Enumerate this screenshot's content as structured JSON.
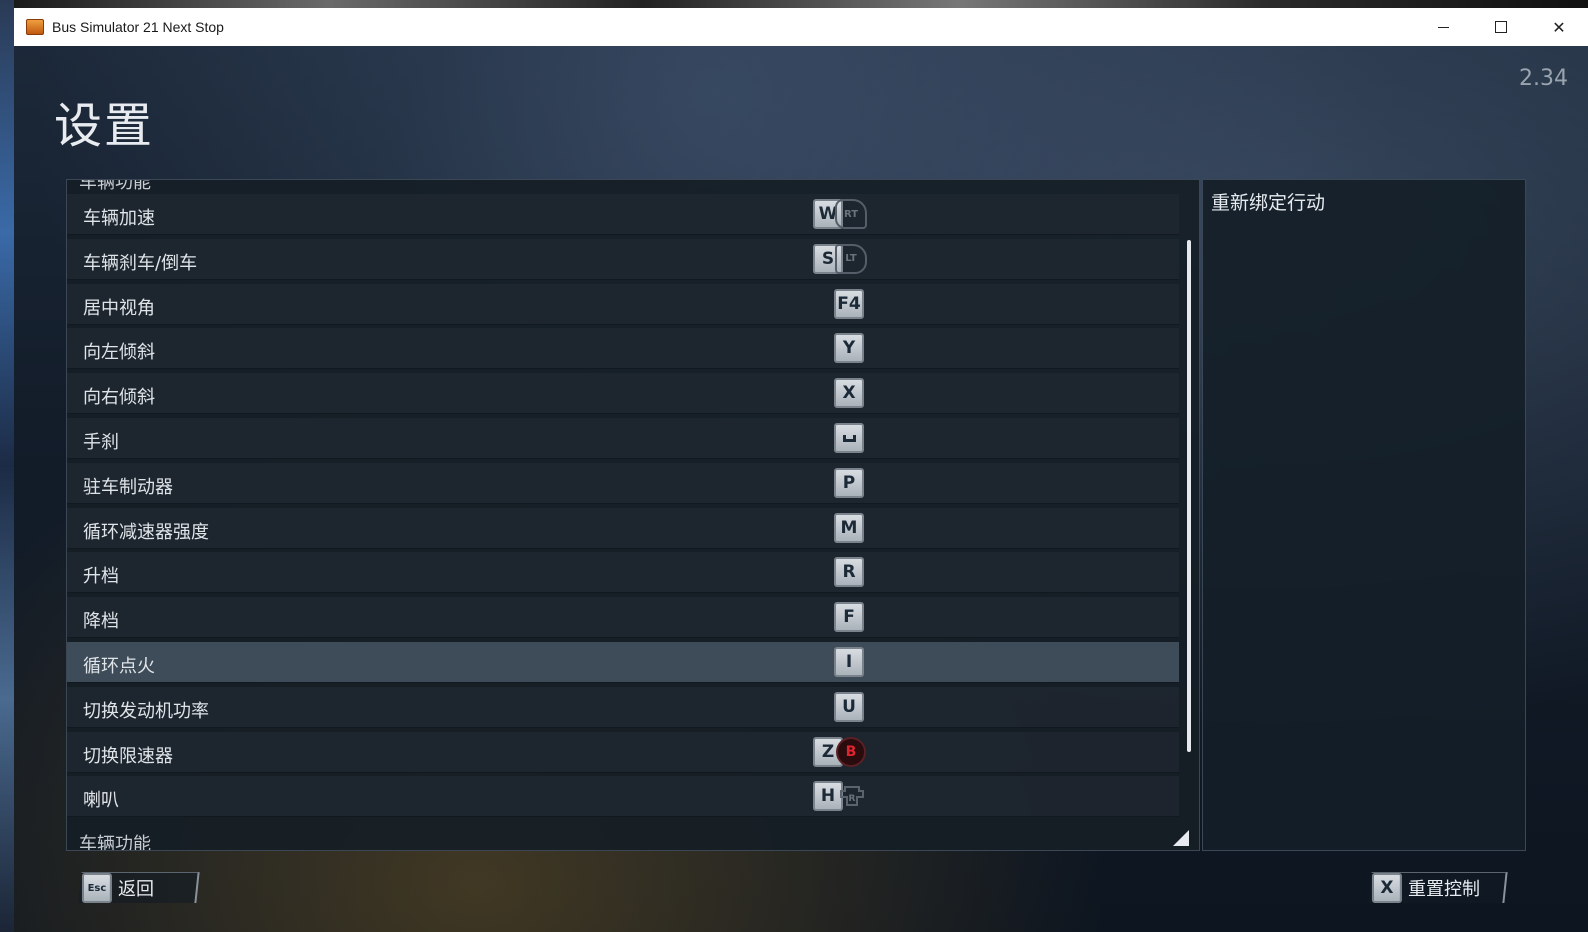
{
  "window": {
    "title": "Bus Simulator 21 Next Stop",
    "minimize_glyph": "minimize",
    "maximize_glyph": "maximize",
    "close_glyph": "✕"
  },
  "page": {
    "title": "设置",
    "version": "2.34"
  },
  "bindings": {
    "section_header_cut": "车辆功能",
    "rows": [
      {
        "label": "车辆加速",
        "key": "W",
        "pad": "RT",
        "pad_type": "trigger-rt"
      },
      {
        "label": "车辆刹车/倒车",
        "key": "S",
        "pad": "LT",
        "pad_type": "trigger-lt"
      },
      {
        "label": "居中视角",
        "key": "F4",
        "pad": "",
        "pad_type": ""
      },
      {
        "label": "向左倾斜",
        "key": "Y",
        "pad": "",
        "pad_type": ""
      },
      {
        "label": "向右倾斜",
        "key": "X",
        "pad": "",
        "pad_type": ""
      },
      {
        "label": "手刹",
        "key": "space",
        "pad": "",
        "pad_type": ""
      },
      {
        "label": "驻车制动器",
        "key": "P",
        "pad": "",
        "pad_type": ""
      },
      {
        "label": "循环减速器强度",
        "key": "M",
        "pad": "",
        "pad_type": ""
      },
      {
        "label": "升档",
        "key": "R",
        "pad": "",
        "pad_type": ""
      },
      {
        "label": "降档",
        "key": "F",
        "pad": "",
        "pad_type": ""
      },
      {
        "label": "循环点火",
        "key": "I",
        "pad": "",
        "pad_type": "",
        "selected": true
      },
      {
        "label": "切换发动机功率",
        "key": "U",
        "pad": "",
        "pad_type": ""
      },
      {
        "label": "切换限速器",
        "key": "Z",
        "pad": "B",
        "pad_type": "button-b"
      },
      {
        "label": "喇叭",
        "key": "H",
        "pad": "R",
        "pad_type": "stick-r"
      }
    ],
    "next_section": "车辆功能"
  },
  "side_panel": {
    "title": "重新绑定行动"
  },
  "footer": {
    "back": {
      "key": "Esc",
      "label": "返回"
    },
    "reset": {
      "key": "X",
      "label": "重置控制"
    }
  },
  "colors": {
    "panel_bg": "#161e26",
    "row_bg": "#1e2630",
    "row_selected": "#3e4b58",
    "key_face": "#c4cbd1",
    "b_button": "#e0242e"
  }
}
